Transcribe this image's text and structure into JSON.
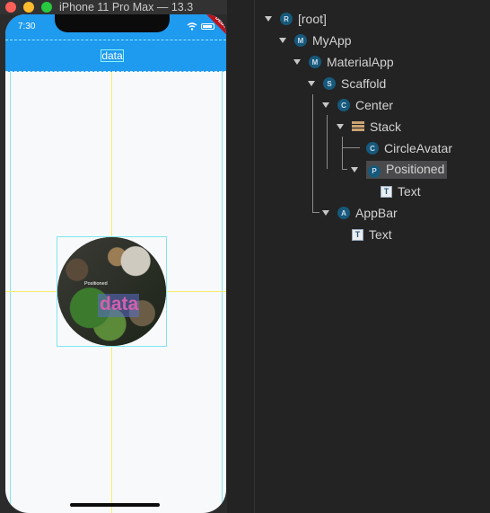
{
  "simulator": {
    "title": "iPhone 11 Pro Max — 13.3",
    "status_time": "7:30",
    "debug_banner": "DEBUG",
    "appbar_title": "data",
    "positioned_label": "Positioned",
    "data_text": "data"
  },
  "colors": {
    "appbar": "#1e9aef",
    "inspector_bg": "#232324",
    "badge": "#17597a",
    "data_text": "#d260ad"
  },
  "widget_tree": [
    {
      "label": "[root]",
      "badge": "R",
      "icon": "circle-badge",
      "selected": false
    },
    {
      "label": "MyApp",
      "badge": "M",
      "icon": "circle-badge",
      "selected": false
    },
    {
      "label": "MaterialApp",
      "badge": "M",
      "icon": "circle-badge",
      "selected": false
    },
    {
      "label": "Scaffold",
      "badge": "S",
      "icon": "circle-badge",
      "selected": false
    },
    {
      "label": "Center",
      "badge": "C",
      "icon": "circle-badge",
      "selected": false
    },
    {
      "label": "Stack",
      "badge": "",
      "icon": "stack-icon",
      "selected": false
    },
    {
      "label": "CircleAvatar",
      "badge": "C",
      "icon": "circle-badge",
      "selected": false
    },
    {
      "label": "Positioned",
      "badge": "P",
      "icon": "circle-badge",
      "selected": true
    },
    {
      "label": "Text",
      "badge": "T",
      "icon": "text-icon",
      "selected": false
    },
    {
      "label": "AppBar",
      "badge": "A",
      "icon": "circle-badge",
      "selected": false
    },
    {
      "label": "Text",
      "badge": "T",
      "icon": "text-icon",
      "selected": false
    }
  ]
}
